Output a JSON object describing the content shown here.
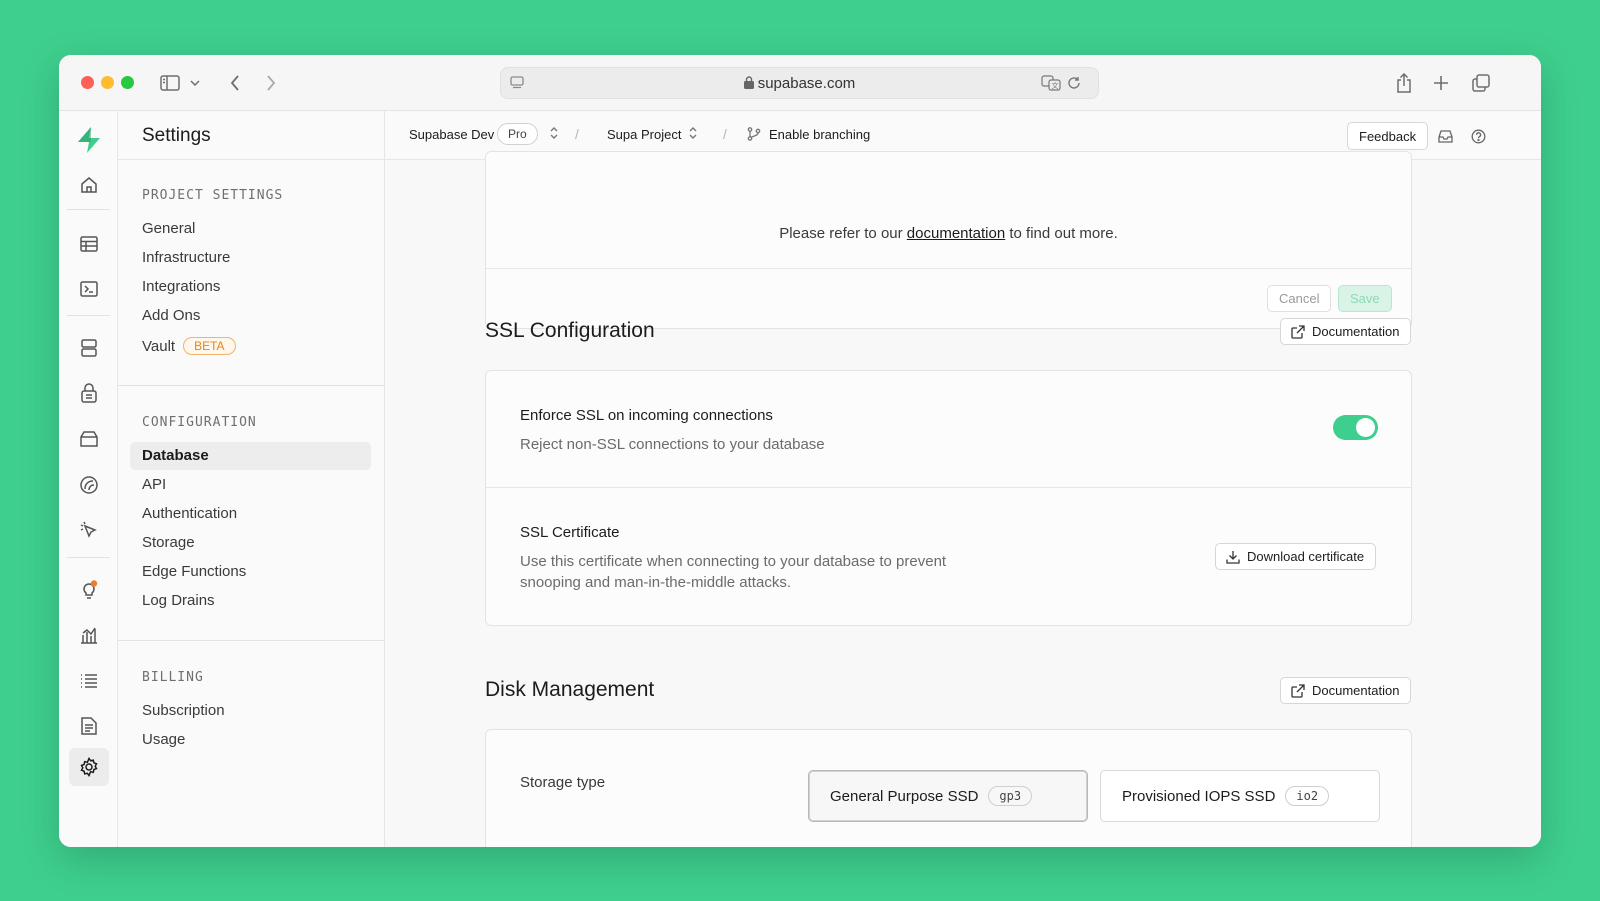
{
  "browser": {
    "url": "supabase.com"
  },
  "sidebar": {
    "title": "Settings",
    "sections": [
      {
        "title": "PROJECT SETTINGS",
        "items": [
          {
            "label": "General"
          },
          {
            "label": "Infrastructure"
          },
          {
            "label": "Integrations"
          },
          {
            "label": "Add Ons"
          },
          {
            "label": "Vault",
            "badge": "BETA"
          }
        ]
      },
      {
        "title": "CONFIGURATION",
        "items": [
          {
            "label": "Database",
            "active": true
          },
          {
            "label": "API"
          },
          {
            "label": "Authentication"
          },
          {
            "label": "Storage"
          },
          {
            "label": "Edge Functions"
          },
          {
            "label": "Log Drains"
          }
        ]
      },
      {
        "title": "BILLING",
        "items": [
          {
            "label": "Subscription"
          },
          {
            "label": "Usage"
          }
        ]
      }
    ]
  },
  "topbar": {
    "org": "Supabase Dev",
    "plan": "Pro",
    "project": "Supa Project",
    "branching": "Enable branching",
    "feedback": "Feedback"
  },
  "prev_card": {
    "text_before": "Please refer to our ",
    "link": "documentation",
    "text_after": " to find out more.",
    "cancel": "Cancel",
    "save": "Save"
  },
  "ssl": {
    "title": "SSL Configuration",
    "doc_button": "Documentation",
    "enforce_label": "Enforce SSL on incoming connections",
    "enforce_desc": "Reject non-SSL connections to your database",
    "enforce_enabled": true,
    "cert_label": "SSL Certificate",
    "cert_desc_line1": "Use this certificate when connecting to your database to prevent",
    "cert_desc_line2": "snooping and man-in-the-middle attacks.",
    "download_button": "Download certificate"
  },
  "disk": {
    "title": "Disk Management",
    "doc_button": "Documentation",
    "storage_type_label": "Storage type",
    "options": [
      {
        "label": "General Purpose SSD",
        "tag": "gp3",
        "selected": true
      },
      {
        "label": "Provisioned IOPS SSD",
        "tag": "io2",
        "selected": false
      }
    ]
  },
  "colors": {
    "brand": "#3ecf8e",
    "beta": "#e0861f",
    "notification_dot": "#f07b2c"
  }
}
